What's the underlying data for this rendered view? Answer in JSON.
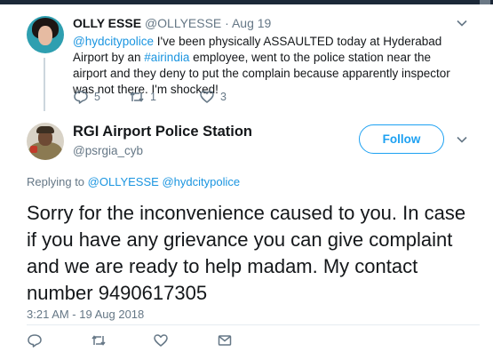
{
  "parent_tweet": {
    "display_name": "OLLY ESSE",
    "handle": "@OLLYESSE",
    "separator": "·",
    "date": "Aug 19",
    "text": {
      "mention": "@hydcitypolice",
      "part1": " I've been physically ASSAULTED today at Hyderabad Airport by an ",
      "hashtag": "#airindia",
      "part2": " employee, went to the police station near the airport and they deny to put the complain because apparently inspector was not there. I'm shocked!"
    },
    "replies": "5",
    "retweets": "1",
    "likes": "3"
  },
  "main_tweet": {
    "display_name": "RGI Airport Police Station",
    "handle": "@psrgia_cyb",
    "follow_label": "Follow",
    "replying_prefix": "Replying to ",
    "replying_to_1": "@OLLYESSE",
    "replying_to_2": "@hydcitypolice",
    "text": "Sorry for the inconvenience caused to you. In case if you have any grievance you can give complaint and we are ready to help madam. My contact number 9490617305",
    "timestamp": "3:21 AM - 19 Aug 2018"
  },
  "icons": {
    "reply": "reply-icon",
    "retweet": "retweet-icon",
    "like": "heart-icon",
    "message": "envelope-icon",
    "caret": "chevron-down-icon"
  },
  "colors": {
    "accent": "#1da1f2",
    "link": "#1b95e0",
    "muted": "#657786",
    "text": "#14171a"
  }
}
